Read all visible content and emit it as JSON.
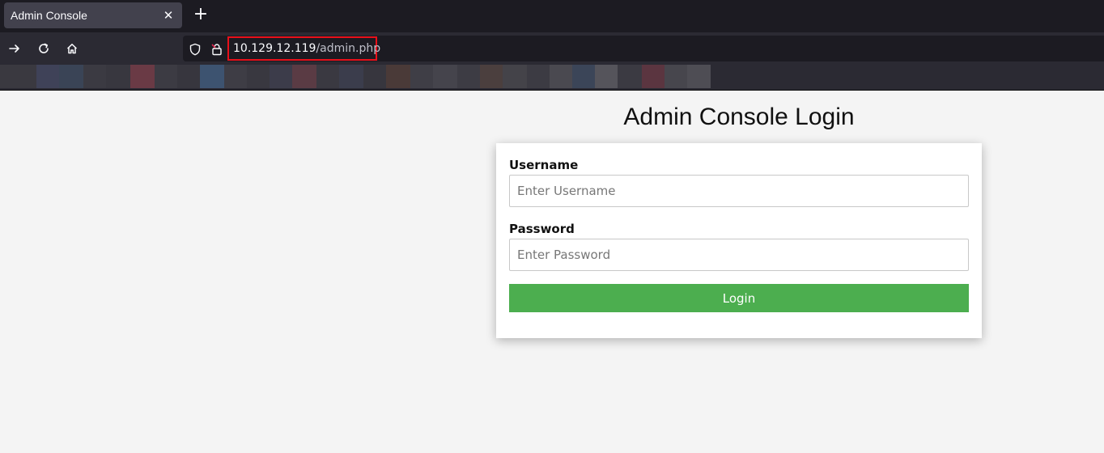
{
  "browser": {
    "tab": {
      "title": "Admin Console",
      "close_glyph": "✕"
    },
    "new_tab_glyph": "+",
    "nav": {
      "forward_icon": "arrow-right-icon",
      "reload_icon": "reload-icon",
      "home_icon": "home-icon"
    },
    "urlbar": {
      "shield_icon": "shield-icon",
      "lock_icon": "insecure-lock-icon",
      "host": "10.129.12.119",
      "path": "/admin.php",
      "highlight_color": "#e8101a"
    }
  },
  "page": {
    "title": "Admin Console Login",
    "form": {
      "username_label": "Username",
      "username_placeholder": "Enter Username",
      "password_label": "Password",
      "password_placeholder": "Enter Password",
      "submit_label": "Login",
      "submit_color": "#4cae4f"
    }
  }
}
